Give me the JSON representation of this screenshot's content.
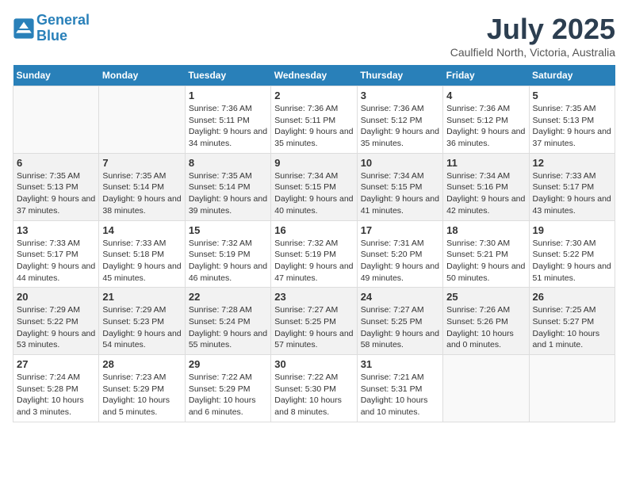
{
  "header": {
    "logo_line1": "General",
    "logo_line2": "Blue",
    "month_year": "July 2025",
    "location": "Caulfield North, Victoria, Australia"
  },
  "days_of_week": [
    "Sunday",
    "Monday",
    "Tuesday",
    "Wednesday",
    "Thursday",
    "Friday",
    "Saturday"
  ],
  "weeks": [
    [
      {
        "day": "",
        "info": ""
      },
      {
        "day": "",
        "info": ""
      },
      {
        "day": "1",
        "info": "Sunrise: 7:36 AM\nSunset: 5:11 PM\nDaylight: 9 hours and 34 minutes."
      },
      {
        "day": "2",
        "info": "Sunrise: 7:36 AM\nSunset: 5:11 PM\nDaylight: 9 hours and 35 minutes."
      },
      {
        "day": "3",
        "info": "Sunrise: 7:36 AM\nSunset: 5:12 PM\nDaylight: 9 hours and 35 minutes."
      },
      {
        "day": "4",
        "info": "Sunrise: 7:36 AM\nSunset: 5:12 PM\nDaylight: 9 hours and 36 minutes."
      },
      {
        "day": "5",
        "info": "Sunrise: 7:35 AM\nSunset: 5:13 PM\nDaylight: 9 hours and 37 minutes."
      }
    ],
    [
      {
        "day": "6",
        "info": "Sunrise: 7:35 AM\nSunset: 5:13 PM\nDaylight: 9 hours and 37 minutes."
      },
      {
        "day": "7",
        "info": "Sunrise: 7:35 AM\nSunset: 5:14 PM\nDaylight: 9 hours and 38 minutes."
      },
      {
        "day": "8",
        "info": "Sunrise: 7:35 AM\nSunset: 5:14 PM\nDaylight: 9 hours and 39 minutes."
      },
      {
        "day": "9",
        "info": "Sunrise: 7:34 AM\nSunset: 5:15 PM\nDaylight: 9 hours and 40 minutes."
      },
      {
        "day": "10",
        "info": "Sunrise: 7:34 AM\nSunset: 5:15 PM\nDaylight: 9 hours and 41 minutes."
      },
      {
        "day": "11",
        "info": "Sunrise: 7:34 AM\nSunset: 5:16 PM\nDaylight: 9 hours and 42 minutes."
      },
      {
        "day": "12",
        "info": "Sunrise: 7:33 AM\nSunset: 5:17 PM\nDaylight: 9 hours and 43 minutes."
      }
    ],
    [
      {
        "day": "13",
        "info": "Sunrise: 7:33 AM\nSunset: 5:17 PM\nDaylight: 9 hours and 44 minutes."
      },
      {
        "day": "14",
        "info": "Sunrise: 7:33 AM\nSunset: 5:18 PM\nDaylight: 9 hours and 45 minutes."
      },
      {
        "day": "15",
        "info": "Sunrise: 7:32 AM\nSunset: 5:19 PM\nDaylight: 9 hours and 46 minutes."
      },
      {
        "day": "16",
        "info": "Sunrise: 7:32 AM\nSunset: 5:19 PM\nDaylight: 9 hours and 47 minutes."
      },
      {
        "day": "17",
        "info": "Sunrise: 7:31 AM\nSunset: 5:20 PM\nDaylight: 9 hours and 49 minutes."
      },
      {
        "day": "18",
        "info": "Sunrise: 7:30 AM\nSunset: 5:21 PM\nDaylight: 9 hours and 50 minutes."
      },
      {
        "day": "19",
        "info": "Sunrise: 7:30 AM\nSunset: 5:22 PM\nDaylight: 9 hours and 51 minutes."
      }
    ],
    [
      {
        "day": "20",
        "info": "Sunrise: 7:29 AM\nSunset: 5:22 PM\nDaylight: 9 hours and 53 minutes."
      },
      {
        "day": "21",
        "info": "Sunrise: 7:29 AM\nSunset: 5:23 PM\nDaylight: 9 hours and 54 minutes."
      },
      {
        "day": "22",
        "info": "Sunrise: 7:28 AM\nSunset: 5:24 PM\nDaylight: 9 hours and 55 minutes."
      },
      {
        "day": "23",
        "info": "Sunrise: 7:27 AM\nSunset: 5:25 PM\nDaylight: 9 hours and 57 minutes."
      },
      {
        "day": "24",
        "info": "Sunrise: 7:27 AM\nSunset: 5:25 PM\nDaylight: 9 hours and 58 minutes."
      },
      {
        "day": "25",
        "info": "Sunrise: 7:26 AM\nSunset: 5:26 PM\nDaylight: 10 hours and 0 minutes."
      },
      {
        "day": "26",
        "info": "Sunrise: 7:25 AM\nSunset: 5:27 PM\nDaylight: 10 hours and 1 minute."
      }
    ],
    [
      {
        "day": "27",
        "info": "Sunrise: 7:24 AM\nSunset: 5:28 PM\nDaylight: 10 hours and 3 minutes."
      },
      {
        "day": "28",
        "info": "Sunrise: 7:23 AM\nSunset: 5:29 PM\nDaylight: 10 hours and 5 minutes."
      },
      {
        "day": "29",
        "info": "Sunrise: 7:22 AM\nSunset: 5:29 PM\nDaylight: 10 hours and 6 minutes."
      },
      {
        "day": "30",
        "info": "Sunrise: 7:22 AM\nSunset: 5:30 PM\nDaylight: 10 hours and 8 minutes."
      },
      {
        "day": "31",
        "info": "Sunrise: 7:21 AM\nSunset: 5:31 PM\nDaylight: 10 hours and 10 minutes."
      },
      {
        "day": "",
        "info": ""
      },
      {
        "day": "",
        "info": ""
      }
    ]
  ]
}
